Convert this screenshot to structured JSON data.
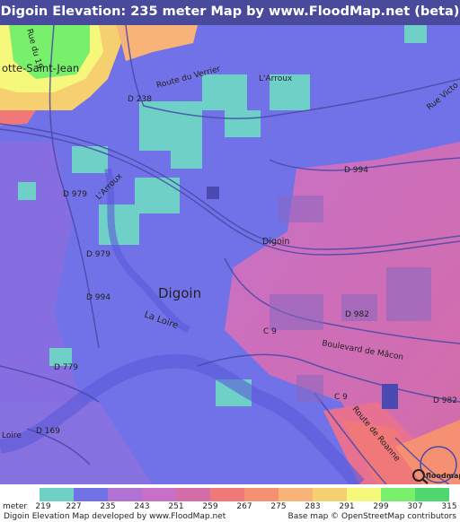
{
  "title": "Digoin Elevation: 235 meter Map by www.FloodMap.net (beta)",
  "map": {
    "places": {
      "paray": "otte-Saint-Jean",
      "digoin_big": "Digoin",
      "digoin_small": "Digoin"
    },
    "roads": {
      "rue_du_19": "Rue du 19",
      "route_verrier": "Route du Verrier",
      "rue_victo": "Rue Victo",
      "d238": "D 238",
      "d994_top": "D 994",
      "d979_a": "D 979",
      "d979_b": "D 979",
      "d994_left": "D 994",
      "c9_a": "C 9",
      "c9_b": "C 9",
      "d982_a": "D 982",
      "d982_b": "D 982",
      "d779": "D 779",
      "d169": "D 169",
      "bd_macon": "Boulevard de Mâcon",
      "route_roanne": "Route de Roanne"
    },
    "water": {
      "arroux_a": "L'Arroux",
      "arroux_b": "L'Arroux",
      "loire_a": "La Loire",
      "loire_b": "Loire"
    },
    "watermark": "floodmap.net"
  },
  "legend": {
    "unit": "meter",
    "ticks": [
      "219",
      "227",
      "235",
      "243",
      "251",
      "259",
      "267",
      "275",
      "283",
      "291",
      "299",
      "307",
      "315"
    ],
    "colors": [
      "#6fd0c8",
      "#7272e8",
      "#b172d4",
      "#c870c8",
      "#d46ca8",
      "#f07878",
      "#f69072",
      "#f8b478",
      "#f6d070",
      "#f6f87c",
      "#78f06c",
      "#50d870"
    ]
  },
  "footer": {
    "left": "Digoin Elevation Map developed by www.FloodMap.net",
    "right": "Base map © OpenStreetMap contributors"
  }
}
